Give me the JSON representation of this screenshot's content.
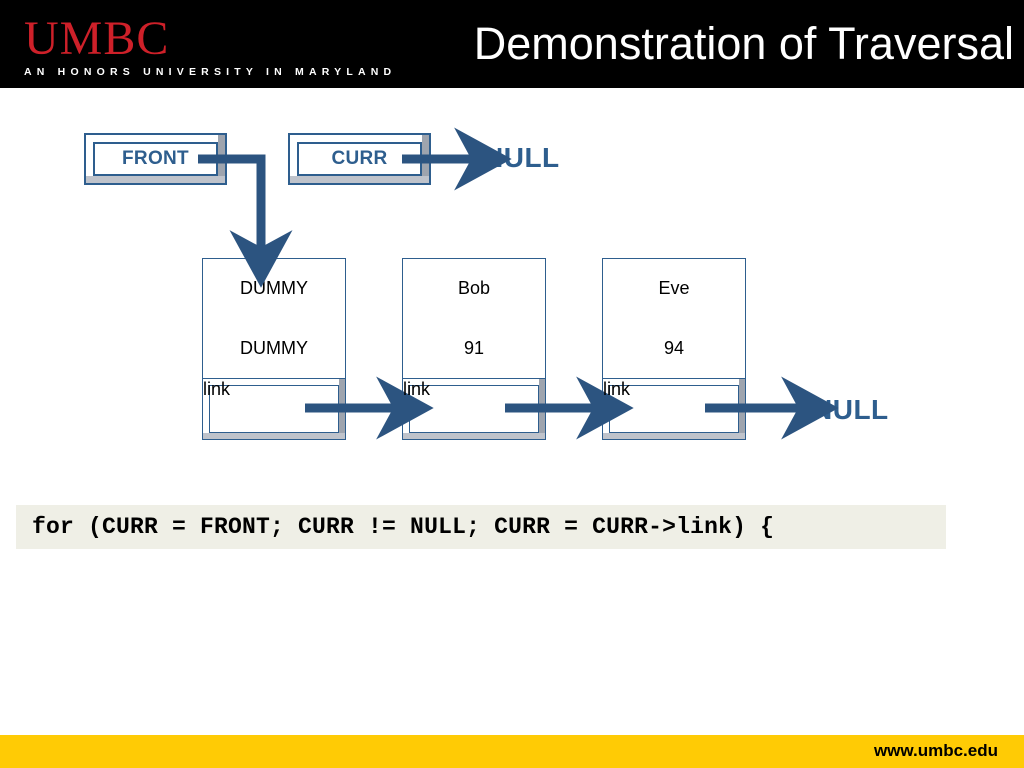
{
  "header": {
    "logo_name": "UMBC",
    "logo_tagline": "AN HONORS UNIVERSITY IN MARYLAND",
    "title": "Demonstration of Traversal",
    "background": "#000000",
    "logo_color": "#CE2029"
  },
  "pointers": [
    {
      "label": "FRONT",
      "target": "dummy-node"
    },
    {
      "label": "CURR",
      "target": "NULL"
    }
  ],
  "null_labels": {
    "top": "NULL",
    "bottom": "NULL"
  },
  "nodes": [
    {
      "name": "DUMMY",
      "value": "DUMMY",
      "link_label": "link"
    },
    {
      "name": "Bob",
      "value": "91",
      "link_label": "link"
    },
    {
      "name": "Eve",
      "value": "94",
      "link_label": "link"
    }
  ],
  "code": {
    "text": "for (CURR = FRONT; CURR != NULL; CURR = CURR->link) {",
    "background": "#EFEFE6"
  },
  "footer": {
    "url": "www.umbc.edu",
    "background": "#FFCB05"
  },
  "colors": {
    "accent_blue": "#2E5E8E",
    "arrow_blue": "#2C5480",
    "bevel_shadow": "#BFC3CB"
  }
}
